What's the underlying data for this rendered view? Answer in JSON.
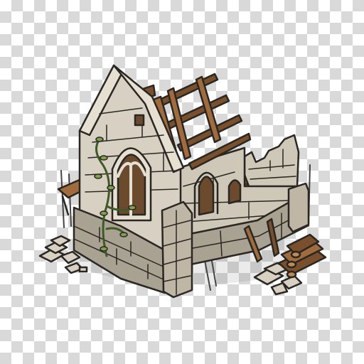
{
  "canvas": {
    "background": "transparency-checkerboard",
    "checker_light": "#ffffff",
    "checker_dark": "#d9d9d9"
  },
  "sprite": {
    "subject": "ruined-stone-chapel",
    "view": "isometric",
    "style": "outlined-cartoon",
    "palette": {
      "outline": "#2a2622",
      "stone_light": "#d8d1c3",
      "stone_mid": "#bfb6a6",
      "stone_shadow": "#9d9484",
      "foundation": "#a9a292",
      "foundation_dark": "#8d8677",
      "wood": "#7a4f2c",
      "wood_light": "#a06b3d",
      "floor_wood": "#8a5a32",
      "window_dark": "#6b4a2e",
      "vine": "#5a7a3a",
      "vine_leaf": "#7fa24f",
      "pole": "#8a8a8a"
    }
  }
}
